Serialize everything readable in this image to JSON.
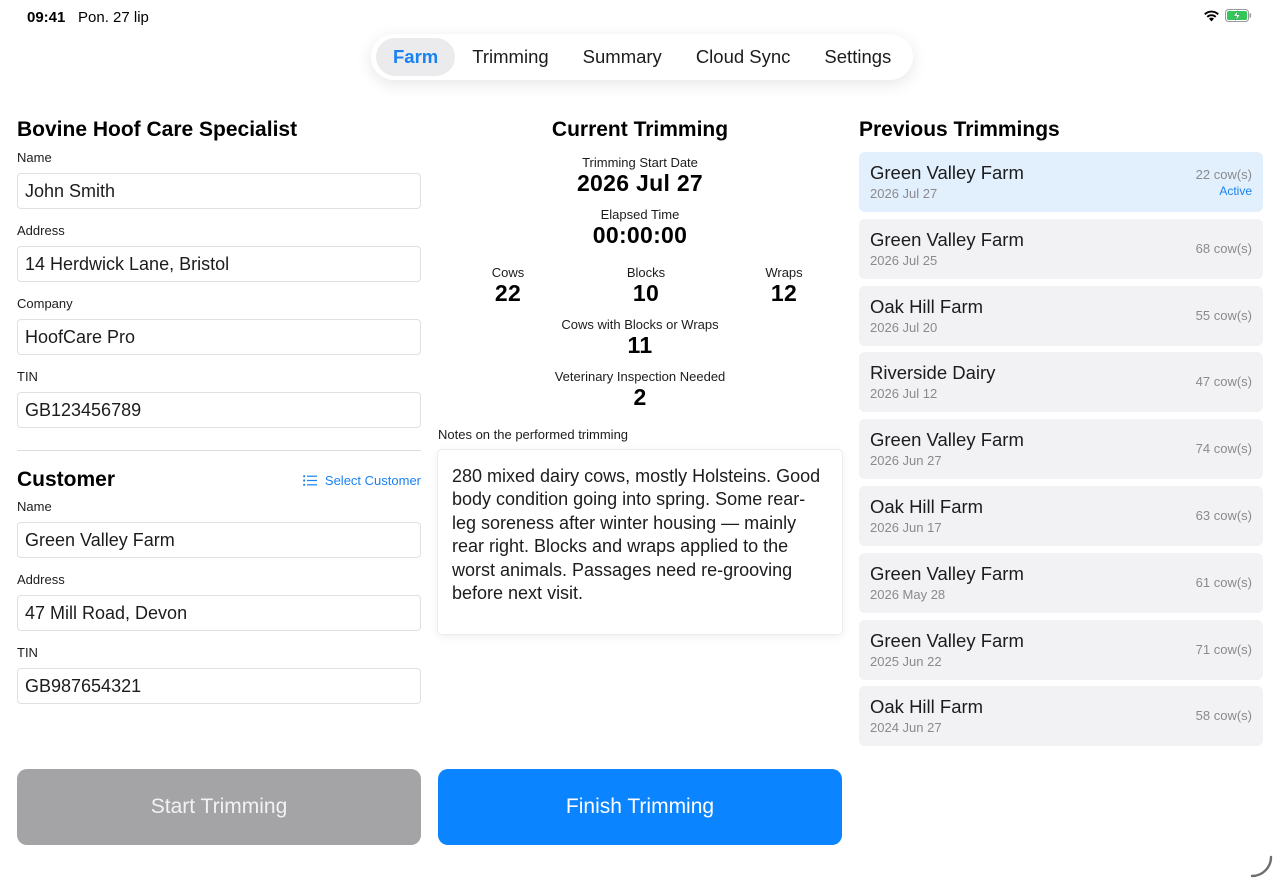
{
  "status_bar": {
    "time": "09:41",
    "date": "Pon. 27 lip"
  },
  "tabs": [
    {
      "label": "Farm",
      "active": true
    },
    {
      "label": "Trimming",
      "active": false
    },
    {
      "label": "Summary",
      "active": false
    },
    {
      "label": "Cloud Sync",
      "active": false
    },
    {
      "label": "Settings",
      "active": false
    }
  ],
  "specialist": {
    "title": "Bovine Hoof Care Specialist",
    "name_label": "Name",
    "name_value": "John Smith",
    "address_label": "Address",
    "address_value": "14 Herdwick Lane, Bristol",
    "company_label": "Company",
    "company_value": "HoofCare Pro",
    "tin_label": "TIN",
    "tin_value": "GB123456789"
  },
  "customer": {
    "title": "Customer",
    "select_label": "Select Customer",
    "name_label": "Name",
    "name_value": "Green Valley Farm",
    "address_label": "Address",
    "address_value": "47 Mill Road, Devon",
    "tin_label": "TIN",
    "tin_value": "GB987654321"
  },
  "current": {
    "title": "Current Trimming",
    "start_label": "Trimming Start Date",
    "start_value": "2026 Jul 27",
    "elapsed_label": "Elapsed Time",
    "elapsed_value": "00:00:00",
    "cows_label": "Cows",
    "cows_value": "22",
    "blocks_label": "Blocks",
    "blocks_value": "10",
    "wraps_label": "Wraps",
    "wraps_value": "12",
    "cbw_label": "Cows with Blocks or Wraps",
    "cbw_value": "11",
    "vet_label": "Veterinary Inspection Needed",
    "vet_value": "2",
    "notes_label": "Notes on the performed trimming",
    "notes_value": "280 mixed dairy cows, mostly Holsteins. Good body condition going into spring. Some rear-leg soreness after winter housing — mainly rear right. Blocks and wraps applied to the worst animals. Passages need re-grooving before next visit."
  },
  "previous": {
    "title": "Previous Trimmings",
    "items": [
      {
        "farm": "Green Valley Farm",
        "date": "2026 Jul 27",
        "count": "22 cow(s)",
        "badge": "Active"
      },
      {
        "farm": "Green Valley Farm",
        "date": "2026 Jul 25",
        "count": "68 cow(s)"
      },
      {
        "farm": "Oak Hill Farm",
        "date": "2026 Jul 20",
        "count": "55 cow(s)"
      },
      {
        "farm": "Riverside Dairy",
        "date": "2026 Jul 12",
        "count": "47 cow(s)"
      },
      {
        "farm": "Green Valley Farm",
        "date": "2026 Jun 27",
        "count": "74 cow(s)"
      },
      {
        "farm": "Oak Hill Farm",
        "date": "2026 Jun 17",
        "count": "63 cow(s)"
      },
      {
        "farm": "Green Valley Farm",
        "date": "2026 May 28",
        "count": "61 cow(s)"
      },
      {
        "farm": "Green Valley Farm",
        "date": "2025 Jun 22",
        "count": "71 cow(s)"
      },
      {
        "farm": "Oak Hill Farm",
        "date": "2024 Jun 27",
        "count": "58 cow(s)"
      }
    ]
  },
  "actions": {
    "start_label": "Start Trimming",
    "finish_label": "Finish Trimming"
  },
  "colors": {
    "accent": "#0a84ff",
    "active_row": "#e2f0fd",
    "disabled_button": "#a4a4a6"
  },
  "icons": {
    "wifi": "wifi-icon",
    "battery": "battery-charging-icon",
    "list": "list-icon"
  }
}
